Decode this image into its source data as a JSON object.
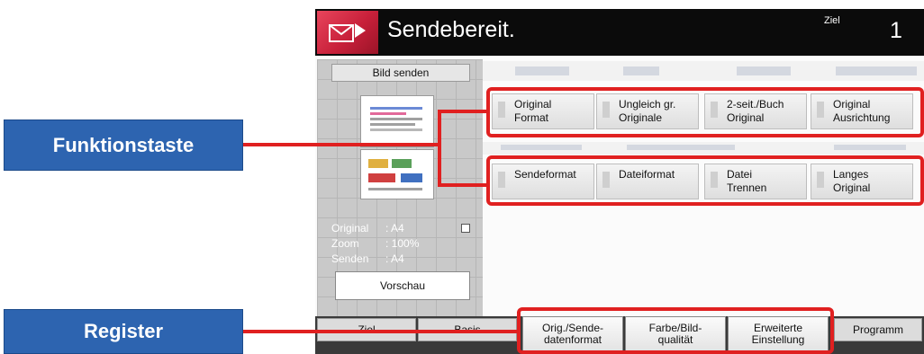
{
  "callouts": {
    "funktionstaste": "Funktionstaste",
    "register": "Register"
  },
  "header": {
    "status": "Sendebereit.",
    "ziel_label": "Ziel",
    "ziel_count": "1"
  },
  "left_panel": {
    "send_image_button": "Bild senden",
    "info": [
      {
        "label": "Original",
        "value": ": A4"
      },
      {
        "label": "Zoom",
        "value": ": 100%"
      },
      {
        "label": "Senden",
        "value": ": A4"
      }
    ],
    "preview_button": "Vorschau"
  },
  "function_keys": {
    "row1": [
      {
        "line1": "Original",
        "line2": "Format"
      },
      {
        "line1": "Ungleich gr.",
        "line2": "Originale"
      },
      {
        "line1": "2-seit./Buch",
        "line2": "Original"
      },
      {
        "line1": "Original",
        "line2": "Ausrichtung"
      }
    ],
    "row2": [
      {
        "line1": "Sendeformat",
        "line2": ""
      },
      {
        "line1": "Dateiformat",
        "line2": ""
      },
      {
        "line1": "Datei",
        "line2": "Trennen"
      },
      {
        "line1": "Langes",
        "line2": "Original"
      }
    ]
  },
  "tabs": {
    "top": [
      "Ziel",
      "Basis"
    ],
    "sub": [
      {
        "line1": "Orig./Sende-",
        "line2": "datenformat"
      },
      {
        "line1": "Farbe/Bild-",
        "line2": "qualität"
      },
      {
        "line1": "Erweiterte",
        "line2": "Einstellung"
      }
    ],
    "program": "Programm"
  },
  "colors": {
    "callout_blue": "#2d64b0",
    "highlight_red": "#e02020",
    "header_black": "#0b0b0b",
    "logo_red": "#c8203a"
  }
}
